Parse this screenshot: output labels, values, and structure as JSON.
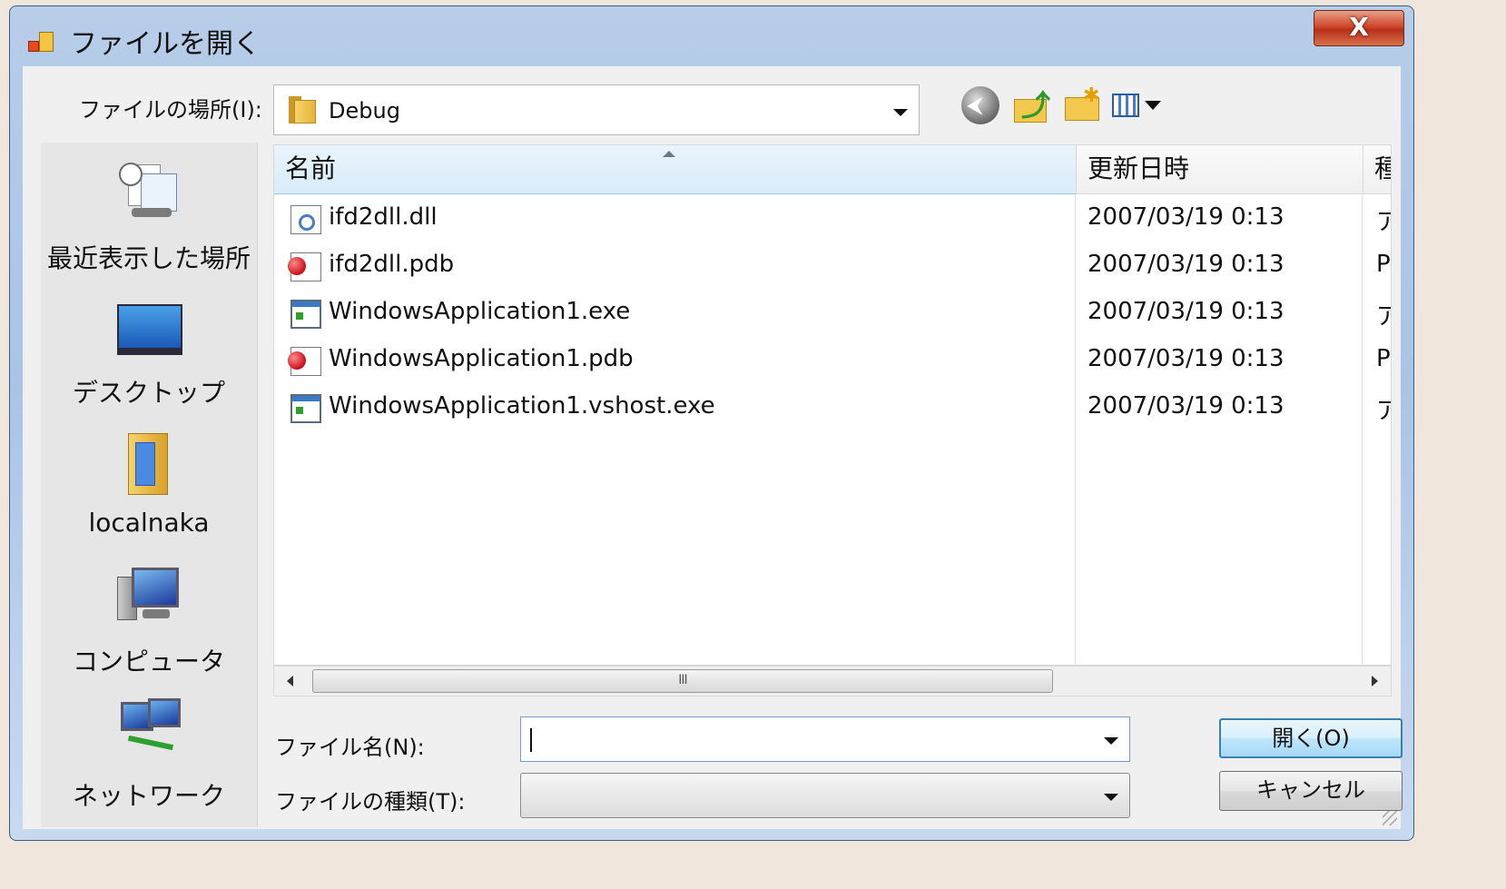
{
  "window": {
    "title": "ファイルを開く",
    "close_label": "X"
  },
  "location": {
    "label": "ファイルの場所(I):",
    "value": "Debug"
  },
  "toolbar": {
    "back_glyph": "⮜"
  },
  "places": [
    {
      "label": "最近表示した場所",
      "icon": "recent-places-icon"
    },
    {
      "label": "デスクトップ",
      "icon": "desktop-icon"
    },
    {
      "label": "localnaka",
      "icon": "user-folder-icon"
    },
    {
      "label": "コンピュータ",
      "icon": "computer-icon"
    },
    {
      "label": "ネットワーク",
      "icon": "network-icon"
    }
  ],
  "columns": {
    "name": "名前",
    "date": "更新日時",
    "type": "種"
  },
  "files": [
    {
      "name": "ifd2dll.dll",
      "date": "2007/03/19 0:13",
      "type": "ア",
      "icon": "dll-file-icon"
    },
    {
      "name": "ifd2dll.pdb",
      "date": "2007/03/19 0:13",
      "type": "P",
      "icon": "pdb-file-icon"
    },
    {
      "name": "WindowsApplication1.exe",
      "date": "2007/03/19 0:13",
      "type": "ア",
      "icon": "exe-file-icon"
    },
    {
      "name": "WindowsApplication1.pdb",
      "date": "2007/03/19 0:13",
      "type": "P",
      "icon": "pdb-file-icon"
    },
    {
      "name": "WindowsApplication1.vshost.exe",
      "date": "2007/03/19 0:13",
      "type": "ア",
      "icon": "exe-file-icon"
    }
  ],
  "scrollbar": {
    "thumb_grip": "III"
  },
  "filename": {
    "label": "ファイル名(N):",
    "value": ""
  },
  "filetype": {
    "label": "ファイルの種類(T):",
    "value": ""
  },
  "buttons": {
    "open": "開く(O)",
    "cancel": "キャンセル"
  }
}
